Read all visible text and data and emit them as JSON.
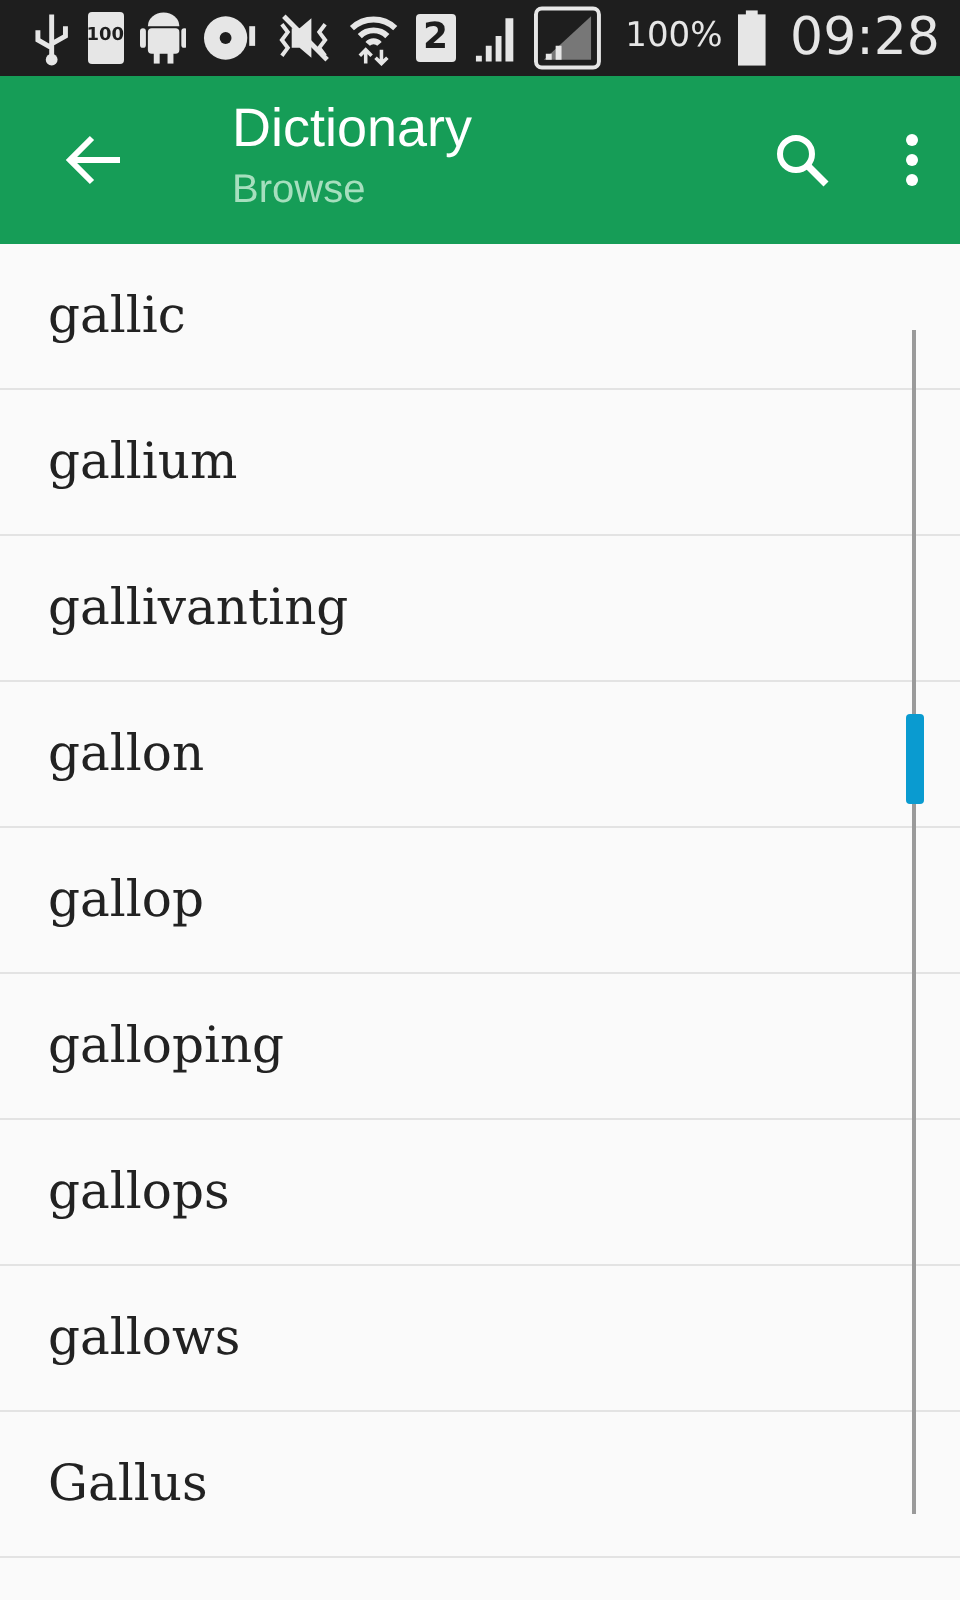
{
  "status_bar": {
    "battery_icon_text": "100",
    "sim_number": "2",
    "battery_percent": "100%",
    "time": "09:28"
  },
  "app_bar": {
    "title": "Dictionary",
    "subtitle": "Browse"
  },
  "words": [
    {
      "text": "gallic"
    },
    {
      "text": "gallium"
    },
    {
      "text": "gallivanting"
    },
    {
      "text": "gallon"
    },
    {
      "text": "gallop"
    },
    {
      "text": "galloping"
    },
    {
      "text": "gallops"
    },
    {
      "text": "gallows"
    },
    {
      "text": "Gallus"
    }
  ]
}
